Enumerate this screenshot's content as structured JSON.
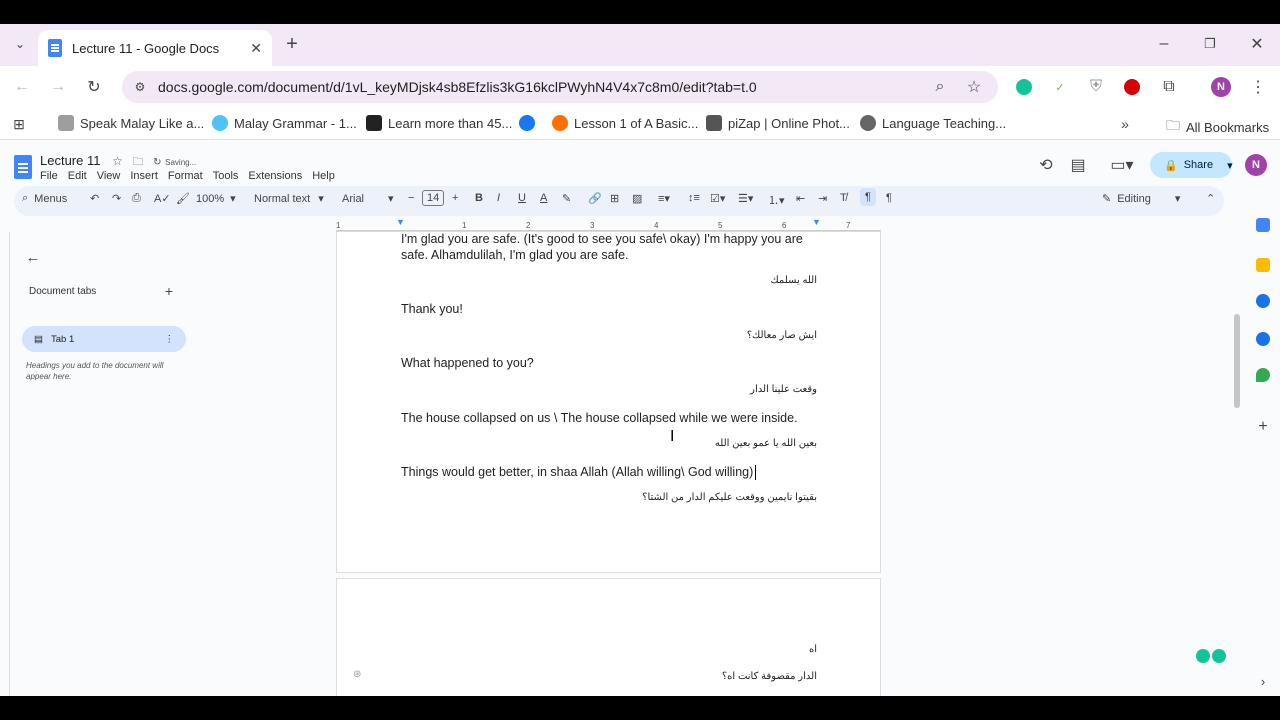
{
  "browser": {
    "tab_title": "Lecture 11 - Google Docs",
    "url": "docs.google.com/document/d/1vL_keyMDjsk4sb8Efzlis3kG16kclPWyhN4V4x7c8m0/edit?tab=t.0",
    "profile_initial": "N",
    "bookmarks": [
      {
        "label": "Speak Malay Like a...",
        "color": "#9e9e9e"
      },
      {
        "label": "Malay Grammar - 1...",
        "color": "#4fc3f7"
      },
      {
        "label": "Learn more than 45...",
        "color": "#222222"
      },
      {
        "label": "",
        "color": "#1877f2"
      },
      {
        "label": "Lesson 1 of A Basic...",
        "color": "#ff6f00"
      },
      {
        "label": "piZap | Online Phot...",
        "color": "#555555"
      },
      {
        "label": "Language Teaching...",
        "color": "#666666"
      }
    ],
    "all_bookmarks": "All Bookmarks"
  },
  "docs": {
    "title": "Lecture 11",
    "status": "Saving...",
    "menu": [
      "File",
      "Edit",
      "View",
      "Insert",
      "Format",
      "Tools",
      "Extensions",
      "Help"
    ],
    "share_label": "Share",
    "user_initial": "N",
    "toolbar": {
      "menus": "Menus",
      "zoom": "100%",
      "style": "Normal text",
      "font": "Arial",
      "size": "14",
      "mode": "Editing"
    }
  },
  "sidebar": {
    "heading": "Document tabs",
    "tab_label": "Tab 1",
    "hint": "Headings you add to the document will appear here."
  },
  "ruler": [
    "1",
    "1",
    "2",
    "3",
    "4",
    "5",
    "6",
    "7"
  ],
  "document": {
    "page1": [
      {
        "type": "en",
        "text": "I'm glad you are safe. (It's good to see you safe\\ okay) I'm happy you are"
      },
      {
        "type": "en",
        "text": "safe. Alhamdulilah, I'm glad you are safe."
      },
      {
        "type": "ar",
        "text": "الله يسلمك"
      },
      {
        "type": "en",
        "text": "Thank you!"
      },
      {
        "type": "ar",
        "text": "ايش صار معالك؟"
      },
      {
        "type": "en",
        "text": "What happened to you?"
      },
      {
        "type": "ar",
        "text": "وقعت علينا الدار"
      },
      {
        "type": "en",
        "text": "The house collapsed on us \\ The house collapsed while we were inside."
      },
      {
        "type": "ar",
        "text": "بعين الله يا عمو بعين الله"
      },
      {
        "type": "en",
        "text": "Things would get better, in shaa Allah (Allah willing\\ God willing)"
      },
      {
        "type": "ar",
        "text": "بقيتوا نايمين ووقعت عليكم الدار من الشتا؟"
      }
    ],
    "page2": [
      {
        "type": "ar",
        "text": "اه"
      },
      {
        "type": "ar",
        "text": "الدار مقصوفة كانت اه؟"
      }
    ]
  }
}
